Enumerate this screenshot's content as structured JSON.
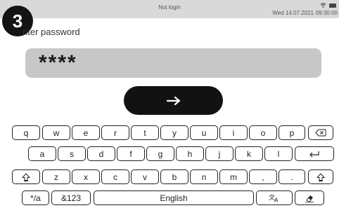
{
  "status_bar": {
    "title": "Not login",
    "date": "Wed 14.07.2021",
    "time": "09:30:00",
    "icons": [
      "wifi-icon",
      "battery-icon"
    ]
  },
  "step": {
    "number": "3"
  },
  "prompt": {
    "label": "nter password"
  },
  "password": {
    "masked_value": "****"
  },
  "submit": {
    "icon": "arrow-right-icon",
    "glyph": "→"
  },
  "keyboard": {
    "row1": [
      "q",
      "w",
      "e",
      "r",
      "t",
      "y",
      "u",
      "i",
      "o",
      "p"
    ],
    "row2": [
      "a",
      "s",
      "d",
      "f",
      "g",
      "h",
      "j",
      "k",
      "l"
    ],
    "row3": [
      "z",
      "x",
      "c",
      "v",
      "b",
      "n",
      "m",
      ",",
      "."
    ],
    "row4": {
      "symbols": "*/a",
      "numbers": "&123",
      "space": "English"
    },
    "icons": [
      "backspace-icon",
      "enter-icon",
      "shift-icon",
      "translate-icon",
      "eraser-icon"
    ]
  },
  "colors": {
    "status_bar": "#d9d9d9",
    "password_field": "#c7c7c7",
    "button": "#121212",
    "badge": "#141414"
  }
}
